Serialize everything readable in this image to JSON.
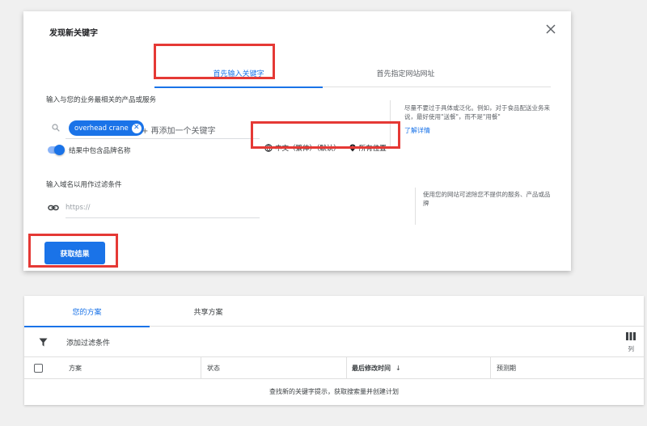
{
  "dialog": {
    "title": "发现新关键字",
    "tabs": [
      "首先输入关键字",
      "首先指定网站网址"
    ],
    "keyword_field_label": "输入与您的业务最相关的产品或服务",
    "chip_text": "overhead crane",
    "add_keyword_text": "+ 再添加一个关键字",
    "brand_toggle_label": "结果中包含品牌名称",
    "brand_toggle_on": true,
    "language": "中文（繁体）（默认）",
    "location": "所有位置",
    "keyword_hint": "尽量不要过于具体或泛化。例如，对于食品配送业务来说，最好使用\"送餐\"，而不是\"用餐\"",
    "learn_more": "了解详情",
    "domain_field_label": "输入域名以用作过滤条件",
    "domain_placeholder": "https://",
    "domain_hint": "使用您的网站可滤除您不提供的服务、产品或品牌",
    "get_results": "获取结果",
    "accent_color": "#1a73e8",
    "highlight_color": "#e53935"
  },
  "plans": {
    "tabs": [
      "您的方案",
      "共享方案"
    ],
    "filter_label": "添加过滤条件",
    "columns_label": "列",
    "headers": [
      "方案",
      "状态",
      "最后修改时间",
      "预测期"
    ],
    "sort_arrow": "↓",
    "empty_message": "查找新的关键字提示，获取搜索量并创建计划"
  }
}
